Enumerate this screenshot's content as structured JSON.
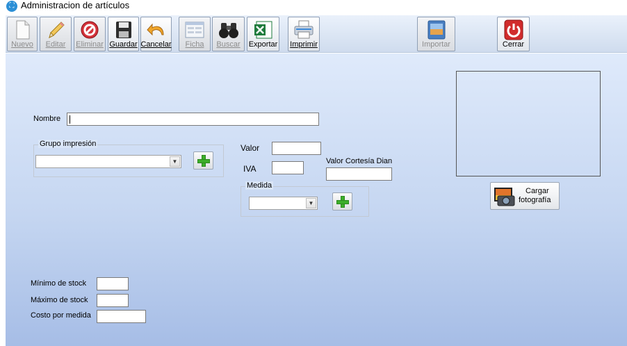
{
  "window": {
    "title": "Administracion de artículos"
  },
  "toolbar": {
    "nuevo": "Nuevo",
    "editar": "Editar",
    "eliminar": "Eliminar",
    "guardar": "Guardar",
    "cancelar": "Cancelar",
    "ficha": "Ficha",
    "buscar": "Buscar",
    "exportar": "Exportar",
    "imprimir": "Imprimir",
    "importar": "Importar",
    "cerrar": "Cerrar"
  },
  "form": {
    "nombre_label": "Nombre",
    "nombre_value": "",
    "grupo_label": "Grupo impresión",
    "grupo_value": "",
    "valor_label": "Valor",
    "valor_value": "",
    "iva_label": "IVA",
    "iva_value": "",
    "valor_cortesia_label": "Valor Cortesía  Dian",
    "valor_cortesia_value": "",
    "medida_label": "Medida",
    "medida_value": "",
    "minimo_label": "Mínimo de stock",
    "minimo_value": "",
    "maximo_label": "Máximo de stock",
    "maximo_value": "",
    "costo_label": "Costo por medida",
    "costo_value": ""
  },
  "photo": {
    "button_line1": "Cargar",
    "button_line2": "fotografía"
  },
  "icons": {
    "nuevo": "new-document-icon",
    "editar": "pencil-icon",
    "eliminar": "delete-icon",
    "guardar": "floppy-disk-icon",
    "cancelar": "undo-arrow-icon",
    "ficha": "form-sheet-icon",
    "buscar": "binoculars-icon",
    "exportar": "excel-icon",
    "imprimir": "printer-icon",
    "importar": "import-icon",
    "cerrar": "power-icon",
    "cargar": "camera-icon"
  }
}
